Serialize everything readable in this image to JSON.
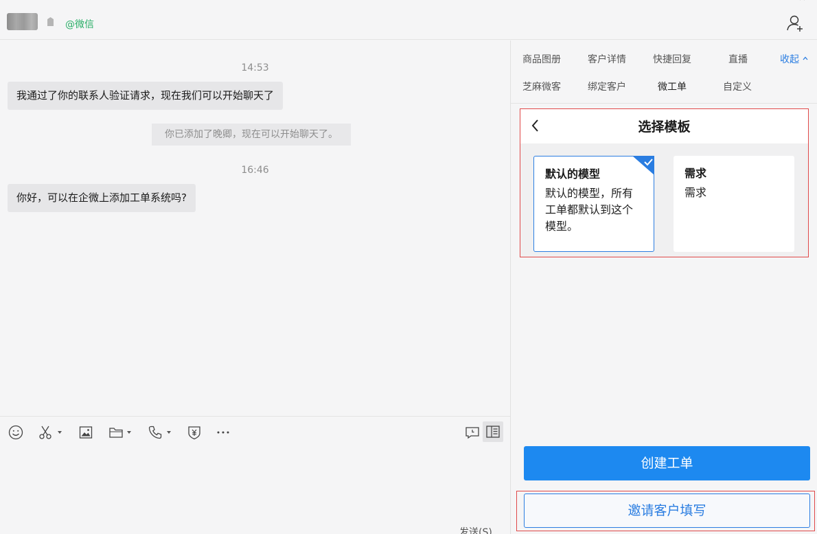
{
  "header": {
    "source_label": "@微信"
  },
  "chat": {
    "messages": [
      {
        "time": "14:53",
        "text": "我通过了你的联系人验证请求，现在我们可以开始聊天了"
      },
      {
        "system": "你已添加了晚卿，现在可以开始聊天了。"
      },
      {
        "time": "16:46",
        "text": "你好，可以在企微上添加工单系统吗?"
      }
    ],
    "send_label": "发送(S)"
  },
  "panel": {
    "tabs_row1": [
      "商品图册",
      "客户详情",
      "快捷回复",
      "直播"
    ],
    "collapse_label": "收起",
    "tabs_row2": [
      "芝麻微客",
      "绑定客户",
      "微工单",
      "自定义"
    ],
    "active_tab": "微工单",
    "template": {
      "title": "选择模板",
      "cards": [
        {
          "title": "默认的模型",
          "desc": "默认的模型，所有工单都默认到这个模型。",
          "selected": true
        },
        {
          "title": "需求",
          "desc": "需求",
          "selected": false
        }
      ]
    },
    "create_button": "创建工单",
    "invite_button": "邀请客户填写"
  },
  "colors": {
    "accent": "#1d89f0",
    "link": "#2a7de1",
    "source_green": "#2aae67",
    "highlight_red": "#e04848"
  }
}
